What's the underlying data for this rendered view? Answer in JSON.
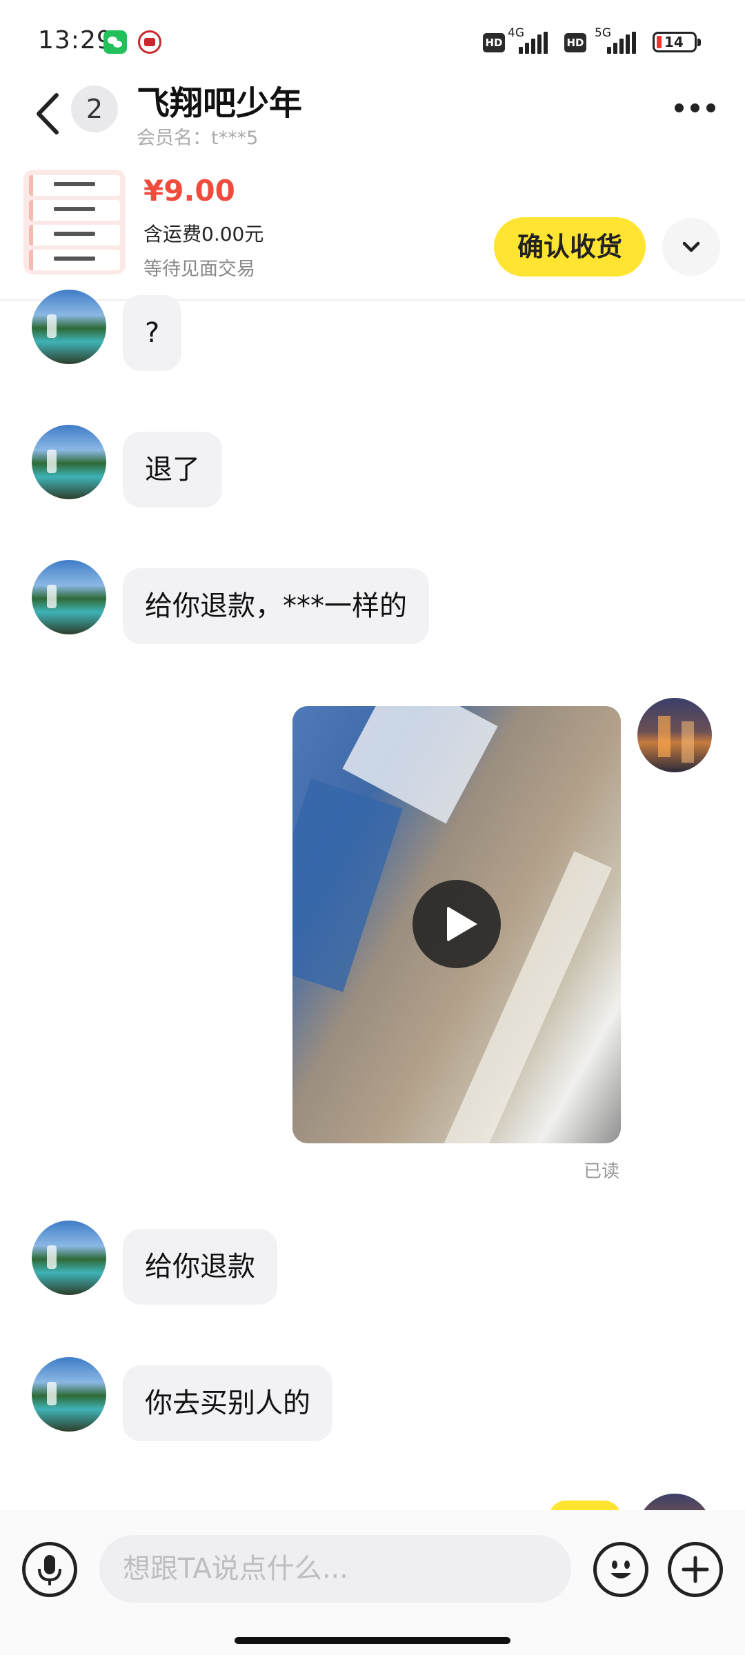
{
  "status_bar": {
    "time": "13:29",
    "sim1_network": "4G",
    "sim2_network": "5G",
    "hd_label": "HD",
    "battery_level": "14",
    "icons": [
      "wechat-icon",
      "app-badge-icon",
      "signal-icon",
      "battery-icon"
    ]
  },
  "header": {
    "unread_count": "2",
    "title": "飞翔吧少年",
    "member_name": "会员名：t***5",
    "icons": [
      "back-arrow-icon",
      "more-icon"
    ]
  },
  "order": {
    "price": "¥9.00",
    "shipping": "含运费0.00元",
    "status": "等待见面交易",
    "confirm_label": "确认收货",
    "expand_icon": "chevron-down-icon"
  },
  "messages": [
    {
      "sender": "peer",
      "type": "text",
      "text": "?"
    },
    {
      "sender": "peer",
      "type": "text",
      "text": "退了"
    },
    {
      "sender": "peer",
      "type": "text",
      "text": "给你退款，***一样的"
    },
    {
      "sender": "self",
      "type": "video",
      "icon": "play-icon",
      "receipt": "已读"
    },
    {
      "sender": "peer",
      "type": "text",
      "text": "给你退款"
    },
    {
      "sender": "peer",
      "type": "text",
      "text": "你去买别人的"
    }
  ],
  "input_bar": {
    "placeholder": "想跟TA说点什么...",
    "icons": [
      "microphone-icon",
      "emoji-icon",
      "plus-icon"
    ]
  },
  "colors": {
    "accent_yellow": "#ffe531",
    "price_red": "#f04c3e",
    "bubble_gray": "#f2f2f4"
  }
}
